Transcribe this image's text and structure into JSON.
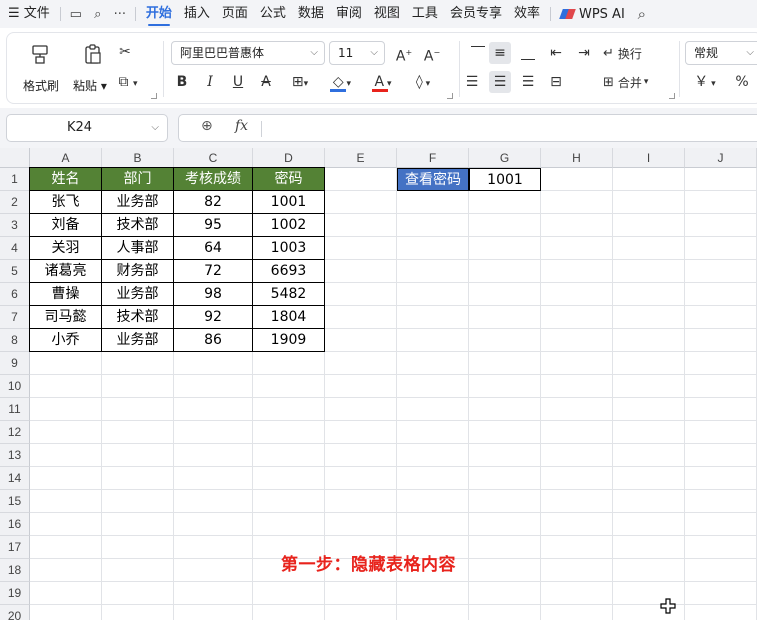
{
  "menubar": {
    "file_label": "文件",
    "tabs": [
      "开始",
      "插入",
      "页面",
      "公式",
      "数据",
      "审阅",
      "视图",
      "工具",
      "会员专享",
      "效率"
    ],
    "active_tab": "开始",
    "wps_ai_label": "WPS AI"
  },
  "ribbon": {
    "format_painter_label": "格式刷",
    "paste_label": "粘贴",
    "font_name": "阿里巴巴普惠体",
    "font_size": "11",
    "wrap_label": "换行",
    "merge_label": "合并",
    "number_format": "常规",
    "currency_symbol": "￥",
    "percent_symbol": "%",
    "font_color": "#e8231c",
    "fill_color": "#2f6fde"
  },
  "formula_bar": {
    "name_box": "K24",
    "fx_label": "fx",
    "formula_value": ""
  },
  "sheet": {
    "columns": [
      "A",
      "B",
      "C",
      "D",
      "E",
      "F",
      "G",
      "H",
      "I",
      "J"
    ],
    "rows": [
      "1",
      "2",
      "3",
      "4",
      "5",
      "6",
      "7",
      "8",
      "9",
      "10",
      "11",
      "12",
      "13",
      "14",
      "15",
      "16",
      "17",
      "18",
      "19",
      "20"
    ],
    "table_headers": [
      "姓名",
      "部门",
      "考核成绩",
      "密码"
    ],
    "table_rows": [
      [
        "张飞",
        "业务部",
        "82",
        "1001"
      ],
      [
        "刘备",
        "技术部",
        "95",
        "1002"
      ],
      [
        "关羽",
        "人事部",
        "64",
        "1003"
      ],
      [
        "诸葛亮",
        "财务部",
        "72",
        "6693"
      ],
      [
        "曹操",
        "业务部",
        "98",
        "5482"
      ],
      [
        "司马懿",
        "技术部",
        "92",
        "1804"
      ],
      [
        "小乔",
        "业务部",
        "86",
        "1909"
      ]
    ],
    "lookup_label": "查看密码",
    "lookup_value": "1001",
    "header_color": "#548235",
    "button_color": "#4472c4"
  },
  "annotation": "第一步：隐藏表格内容"
}
